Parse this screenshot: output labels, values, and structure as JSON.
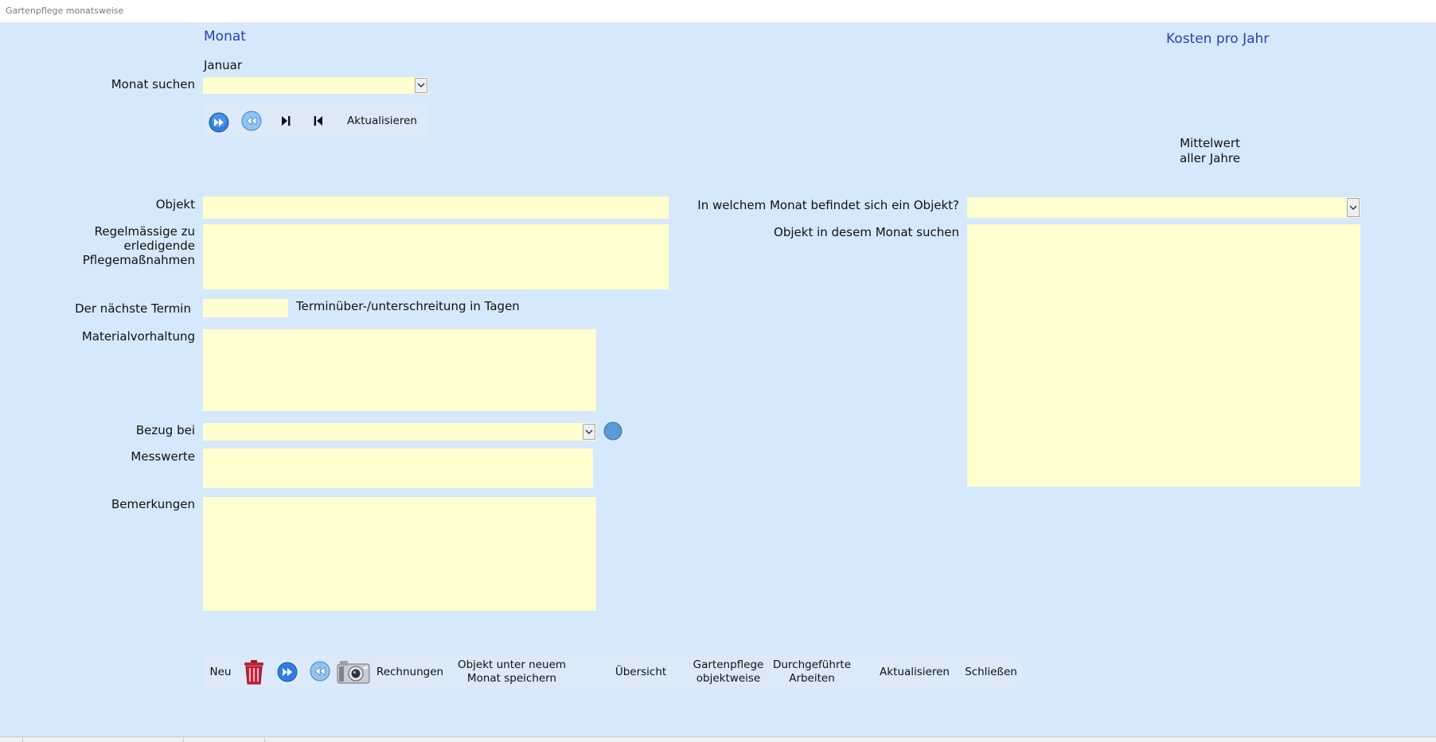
{
  "window": {
    "title": "Gartenpflege monatsweise"
  },
  "header": {
    "month_heading": "Monat",
    "month_value": "Januar",
    "costs_heading": "Kosten pro Jahr",
    "average_label_line1": "Mittelwert",
    "average_label_line2": "aller Jahre"
  },
  "search": {
    "label": "Monat suchen",
    "value": ""
  },
  "nav_toolbar": {
    "refresh_label": "Aktualisieren"
  },
  "form": {
    "objekt_label": "Objekt",
    "objekt_value": "",
    "regelmaessig_label_line1": "Regelmässige zu",
    "regelmaessig_label_line2": "erledigende",
    "regelmaessig_label_line3": "Pflegemaßnahmen",
    "regelmaessig_value": "",
    "termin_label": "Der nächste Termin",
    "termin_value": "",
    "termin_note": "Terminüber-/unterschreitung in Tagen",
    "material_label": "Materialvorhaltung",
    "material_value": "",
    "bezug_label": "Bezug bei",
    "bezug_value": "",
    "messwerte_label": "Messwerte",
    "messwerte_value": "",
    "bemerkungen_label": "Bemerkungen",
    "bemerkungen_value": ""
  },
  "right_panel": {
    "month_question_label": "In welchem Monat befindet sich ein Objekt?",
    "month_question_value": "",
    "object_search_label": "Objekt in desem Monat suchen",
    "object_search_value": ""
  },
  "bottom_toolbar": {
    "new_label": "Neu",
    "invoices_label": "Rechnungen",
    "save_new_month_line1": "Objekt unter neuem",
    "save_new_month_line2": "Monat speichern",
    "overview_label": "Übersicht",
    "per_object_line1": "Gartenpflege",
    "per_object_line2": "objektweise",
    "done_work_line1": "Durchgeführte",
    "done_work_line2": "Arbeiten",
    "refresh_label": "Aktualisieren",
    "close_label": "Schließen"
  },
  "colors": {
    "background": "#d6e8fb",
    "field": "#fefece",
    "heading_blue": "#2a3fb8"
  },
  "icons": [
    "next-record-icon",
    "previous-record-icon",
    "last-record-icon",
    "first-record-icon",
    "trash-icon",
    "camera-icon",
    "circle-button-icon"
  ]
}
